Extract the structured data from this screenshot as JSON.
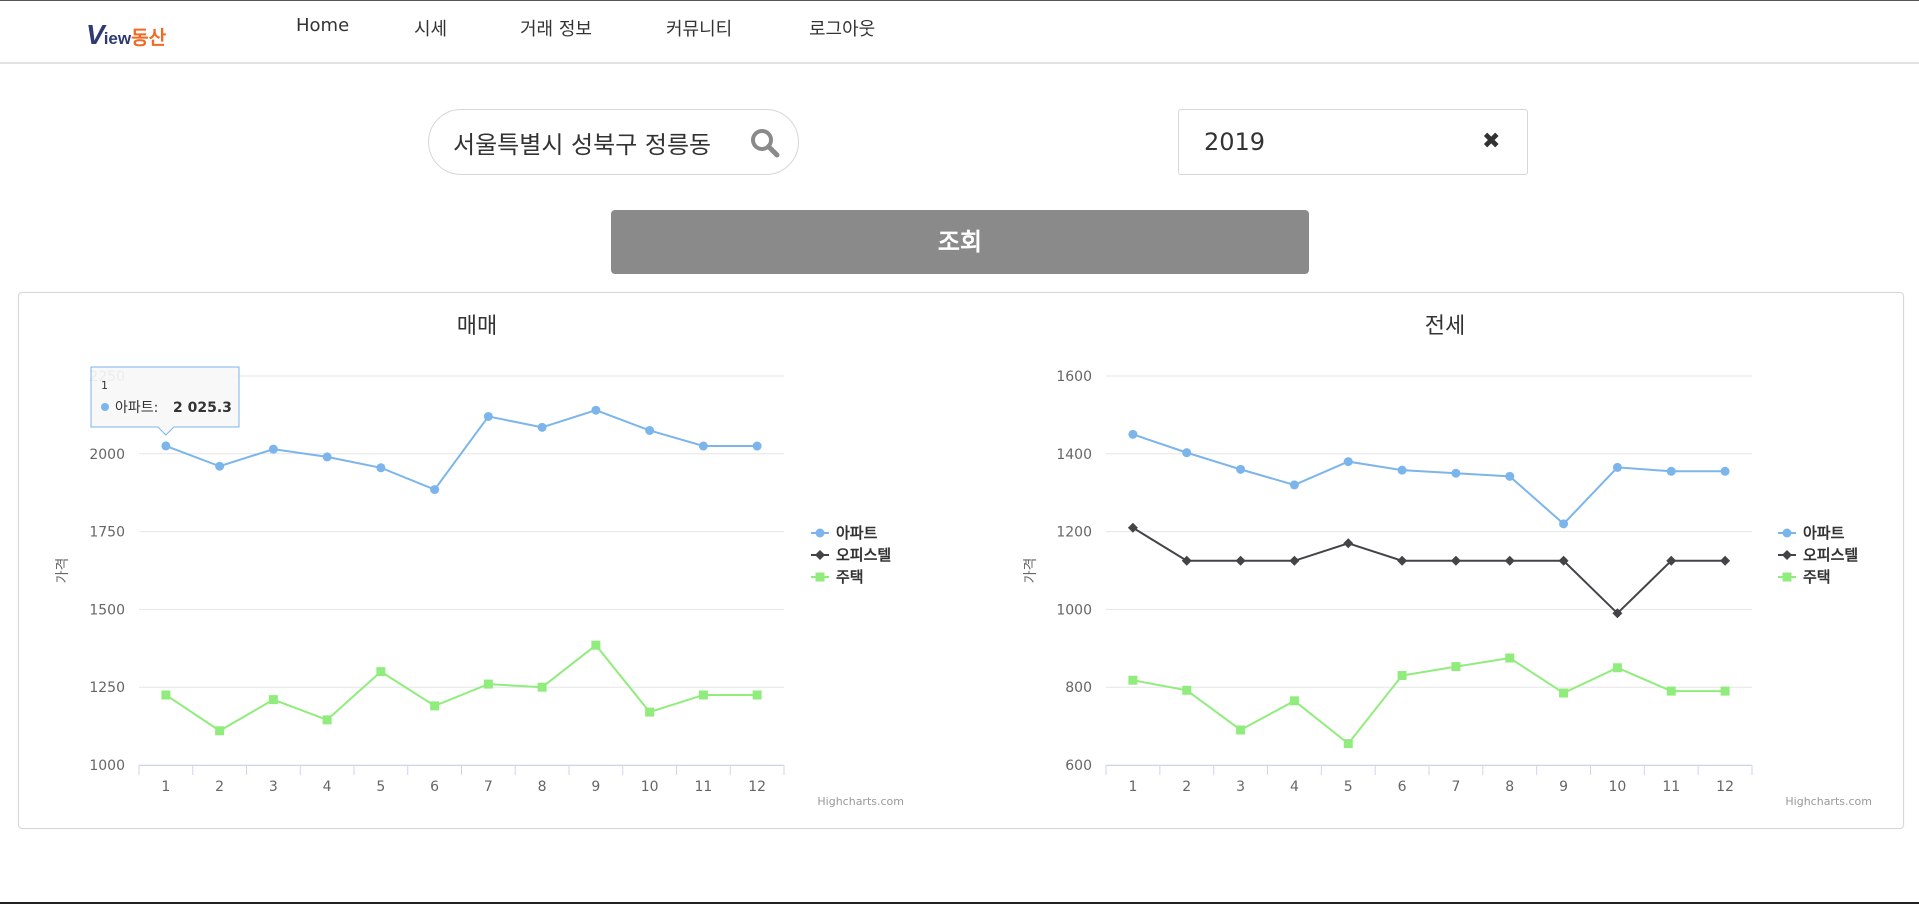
{
  "app": {
    "logo": {
      "v": "V",
      "iew": "iew",
      "dong": "동산"
    }
  },
  "nav": {
    "items": [
      {
        "label": "Home"
      },
      {
        "label": "시세"
      },
      {
        "label": "거래 정보"
      },
      {
        "label": "커뮤니티"
      },
      {
        "label": "로그아웃"
      }
    ]
  },
  "search": {
    "value": "서울특별시 성북구 정릉동",
    "icon": "search-icon"
  },
  "year": {
    "value": "2019",
    "clear_label": "✖"
  },
  "submit": {
    "label": "조회"
  },
  "colors": {
    "apartment": "#7cb5ec",
    "officetel": "#434348",
    "house": "#90ed7d",
    "button": "#8a8a8a",
    "logo_blue": "#2e3a73",
    "logo_orange": "#f26a21"
  },
  "chart_data": [
    {
      "type": "line",
      "title": "매매",
      "ylabel": "가격",
      "xlabel": "",
      "categories": [
        "1",
        "2",
        "3",
        "4",
        "5",
        "6",
        "7",
        "8",
        "9",
        "10",
        "11",
        "12"
      ],
      "ylim": [
        1000,
        2250
      ],
      "yticks": [
        1000,
        1250,
        1500,
        1750,
        2000,
        2250
      ],
      "ytick_labels": [
        "1000",
        "1250",
        "1500",
        "1750",
        "2000",
        "2250"
      ],
      "grid": true,
      "legend_position": "right",
      "series": [
        {
          "name": "아파트",
          "color_key": "apartment",
          "marker": "circle",
          "values": [
            2025.3,
            1960,
            2015,
            1990,
            1955,
            1885,
            2120,
            2085,
            2140,
            2075,
            2025,
            2025
          ]
        },
        {
          "name": "오피스텔",
          "color_key": "officetel",
          "marker": "diamond",
          "values": []
        },
        {
          "name": "주택",
          "color_key": "house",
          "marker": "square",
          "values": [
            1225,
            1110,
            1210,
            1145,
            1300,
            1190,
            1260,
            1250,
            1385,
            1170,
            1225,
            1225
          ]
        }
      ],
      "tooltip": {
        "category": "1",
        "series": "아파트",
        "value": "2 025.3"
      },
      "credits": "Highcharts.com"
    },
    {
      "type": "line",
      "title": "전세",
      "ylabel": "가격",
      "xlabel": "",
      "categories": [
        "1",
        "2",
        "3",
        "4",
        "5",
        "6",
        "7",
        "8",
        "9",
        "10",
        "11",
        "12"
      ],
      "ylim": [
        600,
        1600
      ],
      "yticks": [
        600,
        800,
        1000,
        1200,
        1400,
        1600
      ],
      "ytick_labels": [
        "600",
        "800",
        "1000",
        "1200",
        "1400",
        "1600"
      ],
      "grid": true,
      "legend_position": "right",
      "series": [
        {
          "name": "아파트",
          "color_key": "apartment",
          "marker": "circle",
          "values": [
            1450,
            1403,
            1360,
            1320,
            1380,
            1358,
            1350,
            1342,
            1220,
            1365,
            1355,
            1355
          ]
        },
        {
          "name": "오피스텔",
          "color_key": "officetel",
          "marker": "diamond",
          "values": [
            1210,
            1125,
            1125,
            1125,
            1170,
            1125,
            1125,
            1125,
            1125,
            990,
            1125,
            1125
          ]
        },
        {
          "name": "주택",
          "color_key": "house",
          "marker": "square",
          "values": [
            818,
            792,
            690,
            765,
            655,
            830,
            853,
            875,
            785,
            850,
            790,
            790
          ]
        }
      ],
      "credits": "Highcharts.com"
    }
  ]
}
